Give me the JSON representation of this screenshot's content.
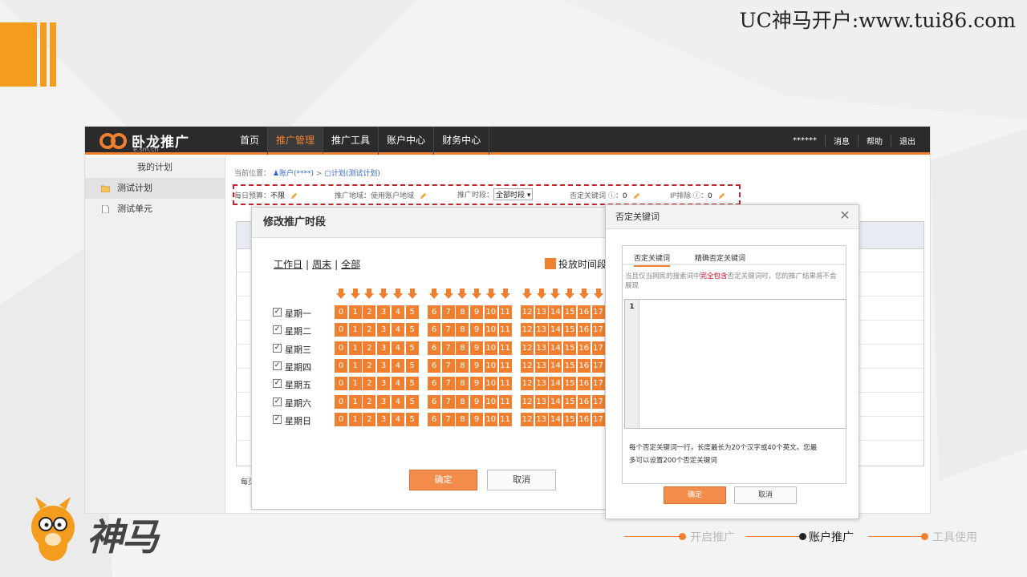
{
  "slide": {
    "title": "UC神马开户:www.tui86.com",
    "mascot_text": "神马",
    "footer_steps": [
      "开启推广",
      "账户推广",
      "工具使用"
    ]
  },
  "app": {
    "logo_text": "卧龙推广",
    "logo_sub": "e.sm.cn",
    "nav": [
      "首页",
      "推广管理",
      "推广工具",
      "账户中心",
      "财务中心"
    ],
    "nav_active": "推广管理",
    "nav_right": [
      "******",
      "消息",
      "帮助",
      "退出"
    ]
  },
  "sidebar": {
    "title": "我的计划",
    "items": [
      {
        "label": "测试计划",
        "icon": "folder-icon"
      },
      {
        "label": "测试单元",
        "icon": "file-icon"
      }
    ]
  },
  "breadcrumb": {
    "prefix": "当前位置：",
    "account": "账户(****)",
    "sep": ">",
    "plan": "计划(测试计划)"
  },
  "info_bar": {
    "budget_label": "每日预算：",
    "budget_value": "不限",
    "region_label": "推广地域：",
    "region_value": "使用账户地域",
    "time_label": "推广时段：",
    "time_value": "全部时段",
    "neg_label": "否定关键词",
    "neg_value": "0",
    "ip_label": "IP排除",
    "ip_value": "0"
  },
  "main": {
    "bottom_text": "每页"
  },
  "schedule_dialog": {
    "title": "修改推广时段",
    "quick": [
      "工作日",
      "周末",
      "全部"
    ],
    "legend": "投放时间段",
    "days": [
      {
        "label": "星期一",
        "checked": true
      },
      {
        "label": "星期二",
        "checked": true
      },
      {
        "label": "星期三",
        "checked": true
      },
      {
        "label": "星期四",
        "checked": true
      },
      {
        "label": "星期五",
        "checked": true
      },
      {
        "label": "星期六",
        "checked": true
      },
      {
        "label": "星期日",
        "checked": true
      }
    ],
    "hours": [
      "0",
      "1",
      "2",
      "3",
      "4",
      "5",
      "6",
      "7",
      "8",
      "9",
      "10",
      "11",
      "12",
      "13",
      "14",
      "15",
      "16",
      "17"
    ],
    "ok": "确定",
    "cancel": "取消"
  },
  "neg_dialog": {
    "title": "否定关键词",
    "tabs": [
      "否定关键词",
      "精确否定关键词"
    ],
    "hint_pre": "当且仅当网民的搜索词中",
    "hint_red": "完全包含",
    "hint_post": "否定关键词时，您的推广结果将不会展现",
    "line_number": "1",
    "note": "每个否定关键词一行，长度最长为20个汉字或40个英文。您最多可以设置200个否定关键词",
    "ok": "确定",
    "cancel": "取消"
  },
  "colors": {
    "accent": "#f08030",
    "brand": "#f39c1d",
    "topbar": "#2b2b2b",
    "alert": "#c0272d"
  }
}
